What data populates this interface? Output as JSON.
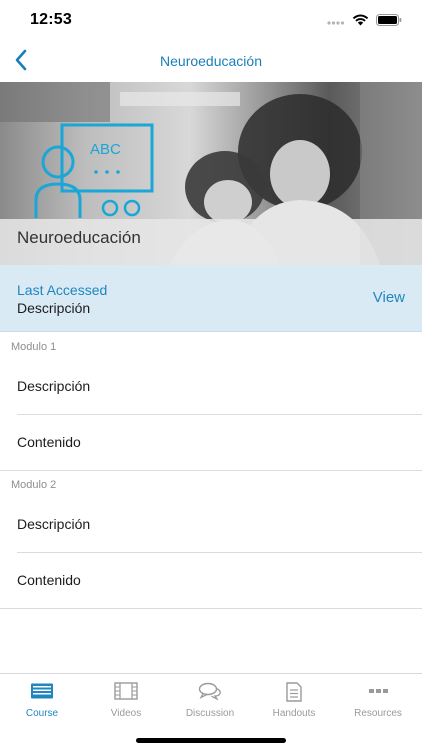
{
  "status_bar": {
    "time": "12:53"
  },
  "nav": {
    "title": "Neuroeducación"
  },
  "hero": {
    "title": "Neuroeducación",
    "board_text": "ABC"
  },
  "last_accessed": {
    "label": "Last Accessed",
    "item": "Descripción",
    "action": "View"
  },
  "modules": [
    {
      "header": "Modulo 1",
      "items": [
        "Descripción",
        "Contenido"
      ]
    },
    {
      "header": "Modulo 2",
      "items": [
        "Descripción",
        "Contenido"
      ]
    }
  ],
  "tabs": [
    {
      "label": "Course",
      "icon": "course-icon",
      "active": true
    },
    {
      "label": "Videos",
      "icon": "film-icon",
      "active": false
    },
    {
      "label": "Discussion",
      "icon": "chat-bubbles-icon",
      "active": false
    },
    {
      "label": "Handouts",
      "icon": "document-icon",
      "active": false
    },
    {
      "label": "Resources",
      "icon": "more-dots-icon",
      "active": false
    }
  ],
  "colors": {
    "accent": "#1f86c0",
    "highlight_band": "#daeaf5",
    "inactive_tab": "#9a9a9e"
  }
}
